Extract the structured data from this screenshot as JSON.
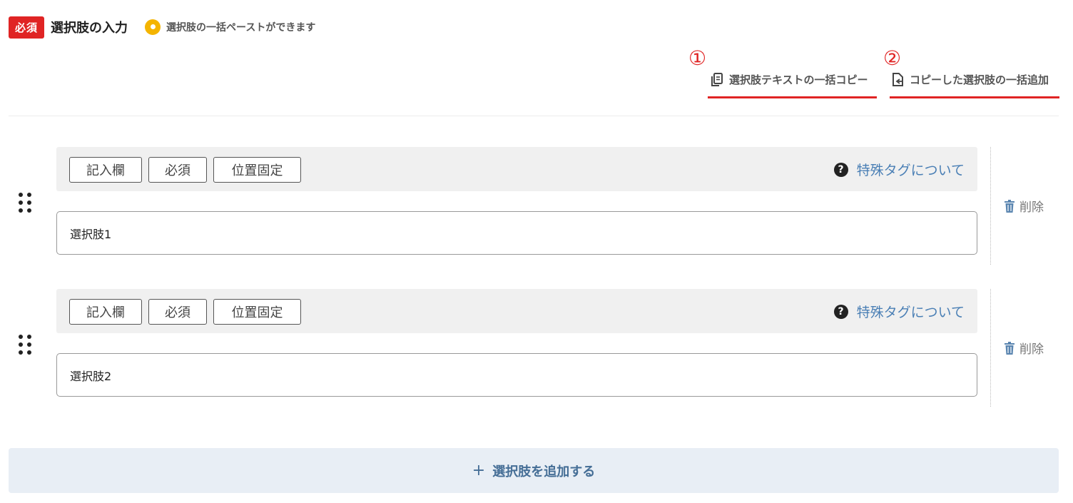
{
  "header": {
    "required_badge": "必須",
    "title": "選択肢の入力",
    "hint_icon": "lightbulb-icon",
    "hint_text": "選択肢の一括ペーストができます"
  },
  "annotations": {
    "marker_1": "①",
    "marker_2": "②",
    "highlight_color": "#e02424"
  },
  "actions": {
    "bulk_copy_label": "選択肢テキストの一括コピー",
    "bulk_copy_icon": "copy-icon",
    "bulk_add_label": "コピーした選択肢の一括追加",
    "bulk_add_icon": "paste-file-icon"
  },
  "choices": [
    {
      "tags": [
        "記入欄",
        "必須",
        "位置固定"
      ],
      "special_tag_label": "特殊タグについて",
      "value": "選択肢1",
      "delete_label": "削除"
    },
    {
      "tags": [
        "記入欄",
        "必須",
        "位置固定"
      ],
      "special_tag_label": "特殊タグについて",
      "value": "選択肢2",
      "delete_label": "削除"
    }
  ],
  "add_choice": {
    "plus": "+",
    "label": "選択肢を追加する"
  },
  "colors": {
    "accent_blue": "#4a7fb5",
    "required_red": "#e02424",
    "hint_yellow": "#f4b400"
  }
}
